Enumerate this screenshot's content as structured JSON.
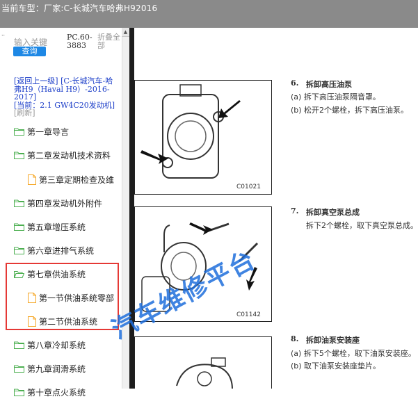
{
  "window": {
    "title": "当前车型：厂家:C-长城汽车哈弗H92016"
  },
  "sidebar": {
    "dots": "..",
    "search": {
      "placeholder": "输入关键",
      "button": "查询"
    },
    "pc_code": "PC.60-3883",
    "collapse_all": "折叠全部",
    "breadcrumb": {
      "back": "[返回上一级]",
      "parent": "[C-长城汽车-哈弗H9（Haval H9）-2016-2017]",
      "current_prefix": "[当前：",
      "current": "2.1 GW4C20发动机]",
      "refresh": "[刷新]"
    },
    "tree": [
      {
        "label": "第一章导言",
        "type": "folder"
      },
      {
        "label": "第二章发动机技术资料",
        "type": "folder"
      },
      {
        "label": "第三章定期检查及维",
        "type": "file"
      },
      {
        "label": "第四章发动机外附件",
        "type": "folder"
      },
      {
        "label": "第五章增压系统",
        "type": "folder"
      },
      {
        "label": "第六章进排气系统",
        "type": "folder"
      },
      {
        "label": "第七章供油系统",
        "type": "folder-open"
      },
      {
        "label": "第一节供油系统零部",
        "type": "file"
      },
      {
        "label": "第二节供油系统",
        "type": "file"
      },
      {
        "label": "第八章冷却系统",
        "type": "folder"
      },
      {
        "label": "第九章润滑系统",
        "type": "folder"
      },
      {
        "label": "第十章点火系统",
        "type": "folder"
      }
    ]
  },
  "document": {
    "steps": [
      {
        "num": "6.",
        "title": "拆卸高压油泵",
        "lines": [
          "(a) 拆下高压油泵隔音罩。",
          "(b) 松开2个螺栓，拆下高压油泵。"
        ],
        "figure": "C01021"
      },
      {
        "num": "7.",
        "title": "拆卸真空泵总成",
        "lines": [
          "拆下2个螺栓，取下真空泵总成。"
        ],
        "figure": "C01142"
      },
      {
        "num": "8.",
        "title": "拆卸油泵安装座",
        "lines": [
          "(a) 拆下5个螺栓，取下油泵安装座。",
          "(b) 取下油泵安装座垫片。"
        ],
        "figure": ""
      }
    ],
    "watermark": "汽车维修平台"
  },
  "colors": {
    "titlebar": "#8a8a8a",
    "accent": "#1e88e5",
    "highlight": "#e53935",
    "folder": "#4caf50",
    "file": "#f5a623"
  }
}
